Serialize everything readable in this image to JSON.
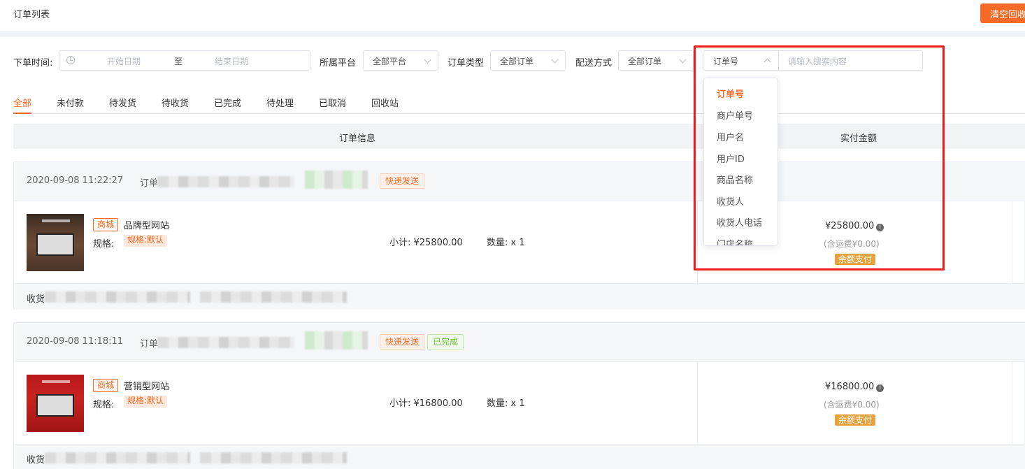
{
  "header": {
    "title": "订单列表",
    "clear_button": "清空回收站"
  },
  "filters": {
    "order_time_label": "下单时间:",
    "start_placeholder": "开始日期",
    "to_label": "至",
    "end_placeholder": "结束日期",
    "platform_label": "所属平台",
    "platform_value": "全部平台",
    "order_type_label": "订单类型",
    "order_type_value": "全部订单",
    "delivery_label": "配送方式",
    "delivery_value": "全部订单",
    "search_field_value": "订单号",
    "search_placeholder": "请输入搜索内容"
  },
  "tabs": [
    "全部",
    "未付款",
    "待发货",
    "待收货",
    "已完成",
    "待处理",
    "已取消",
    "回收站"
  ],
  "active_tab": "全部",
  "table_headers": {
    "order_info": "订单信息",
    "paid_amount": "实付金额"
  },
  "search_dropdown": {
    "selected": "订单号",
    "options": [
      "订单号",
      "商户单号",
      "用户名",
      "用户ID",
      "商品名称",
      "收货人",
      "收货人电话",
      "门店名称"
    ]
  },
  "orders": [
    {
      "datetime": "2020-09-08 11:22:27",
      "order_label": "订单",
      "tags": [
        "快递发送"
      ],
      "shop_tag": "商城",
      "product_name": "品牌型网站",
      "spec_label": "规格:",
      "spec_value": "规格:默认",
      "subtotal": "小计: ¥25800.00",
      "quantity": "数量: x 1",
      "paid": "¥25800.00",
      "shipping": "(含运费¥0.00)",
      "pay_method": "余额支付",
      "receiver_label": "收货"
    },
    {
      "datetime": "2020-09-08 11:18:11",
      "order_label": "订单",
      "tags": [
        "快递发送",
        "已完成"
      ],
      "shop_tag": "商城",
      "product_name": "营销型网站",
      "spec_label": "规格:",
      "spec_value": "规格:默认",
      "subtotal": "小计: ¥16800.00",
      "quantity": "数量: x 1",
      "paid": "¥16800.00",
      "shipping": "(含运费¥0.00)",
      "pay_method": "余额支付",
      "receiver_label": "收货"
    }
  ],
  "colors": {
    "accent": "#f56a26",
    "success": "#67c23a",
    "highlight_box": "#ee1c1c",
    "pay_badge": "#e6a23c"
  },
  "icons": [
    "clock-icon",
    "chevron-down-icon",
    "chevron-up-icon",
    "info-icon"
  ]
}
